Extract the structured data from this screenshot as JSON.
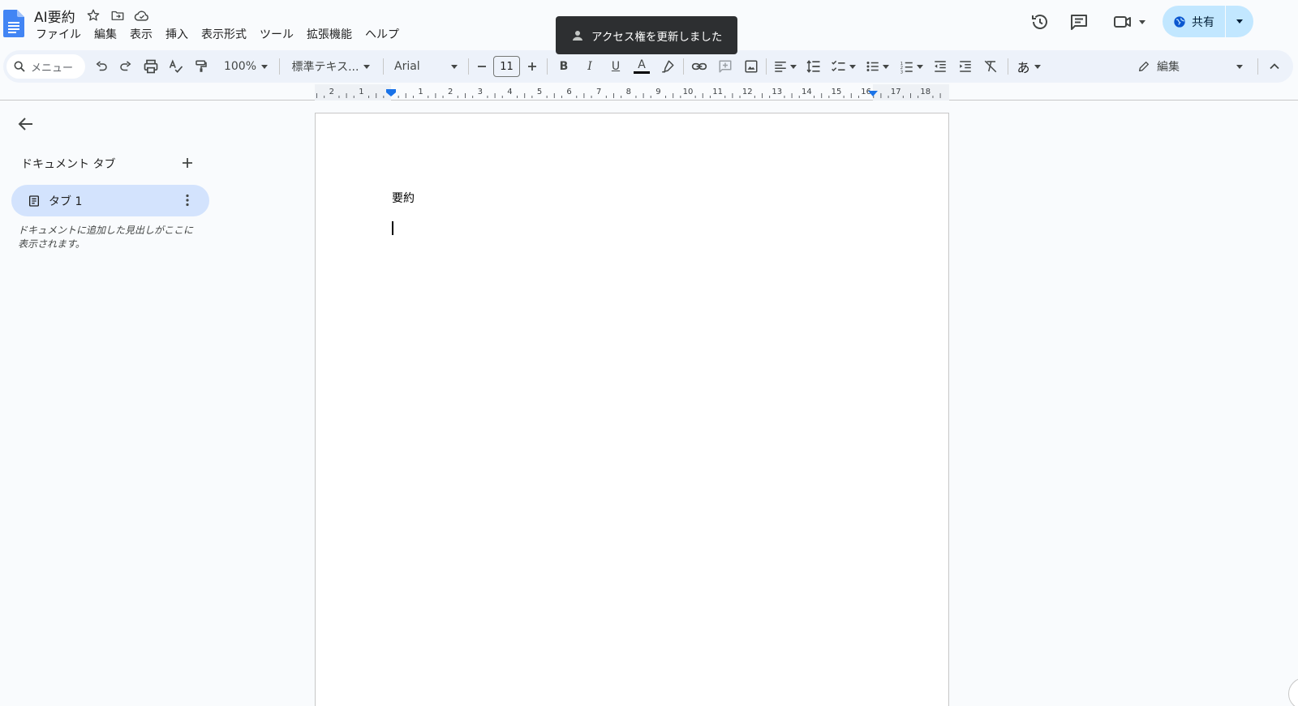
{
  "header": {
    "title": "AI要約",
    "menu": [
      "ファイル",
      "編集",
      "表示",
      "挿入",
      "表示形式",
      "ツール",
      "拡張機能",
      "ヘルプ"
    ],
    "share_label": "共有"
  },
  "toast": {
    "message": "アクセス権を更新しました"
  },
  "toolbar": {
    "search_placeholder": "メニュー",
    "zoom": "100%",
    "style": "標準テキス...",
    "font": "Arial",
    "font_size": "11",
    "bold": "B",
    "italic": "I",
    "underline": "U",
    "text_color": "A",
    "input_tool": "あ",
    "mode": "編集"
  },
  "ruler": {
    "labels": [
      "2",
      "1",
      "1",
      "2",
      "3",
      "4",
      "5",
      "6",
      "7",
      "8",
      "9",
      "10",
      "11",
      "12",
      "13",
      "14",
      "15",
      "16",
      "17",
      "18"
    ]
  },
  "sidebar": {
    "tabs_title": "ドキュメント タブ",
    "tabs": [
      {
        "label": "タブ 1"
      }
    ],
    "hint": "ドキュメントに追加した見出しがここに表示されます。"
  },
  "document": {
    "body_text": "要約"
  },
  "colors": {
    "accent": "#1a73e8",
    "share_bg": "#c2e7ff",
    "tab_active_bg": "#d3e3fd",
    "toolbar_bg": "#edf2fa",
    "toast_bg": "#2d2f31"
  }
}
